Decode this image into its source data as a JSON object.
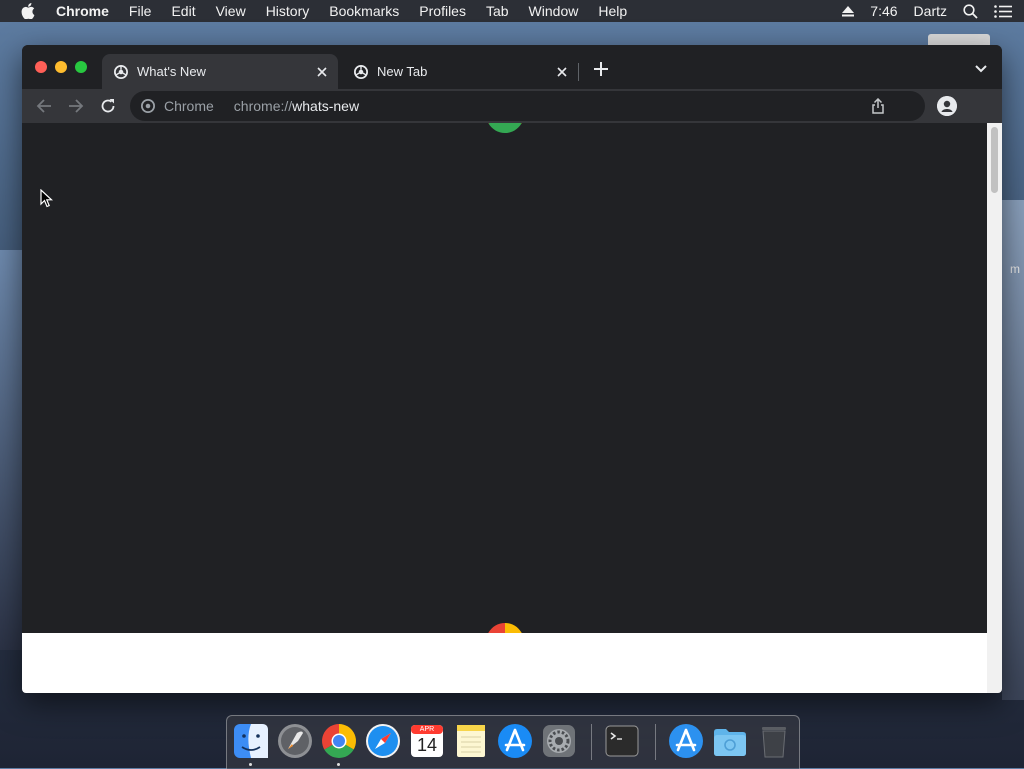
{
  "menubar": {
    "app_name": "Chrome",
    "items": [
      "File",
      "Edit",
      "View",
      "History",
      "Bookmarks",
      "Profiles",
      "Tab",
      "Window",
      "Help"
    ],
    "clock": "7:46",
    "user": "Dartz"
  },
  "desktop": {
    "side_label": "m"
  },
  "browser": {
    "tabs": [
      {
        "title": "What's New",
        "active": true
      },
      {
        "title": "New Tab",
        "active": false
      }
    ],
    "omnibox": {
      "chip_label": "Chrome",
      "scheme": "chrome://",
      "host": "whats-new"
    }
  },
  "dock": {
    "calendar_month": "APR",
    "calendar_day": "14",
    "apps": [
      "finder",
      "launchpad",
      "chrome",
      "safari",
      "calendar",
      "notes",
      "app-store",
      "system-preferences",
      "terminal",
      "downloads-app-store",
      "folder",
      "trash"
    ]
  },
  "colors": {
    "menubar_bg": "#28282c",
    "tabstrip_bg": "#202124",
    "toolbar_bg": "#35363a",
    "page_dark": "#202124",
    "chrome_green": "#34a853",
    "chrome_yellow": "#fbbc04",
    "chrome_red": "#ea4335"
  }
}
